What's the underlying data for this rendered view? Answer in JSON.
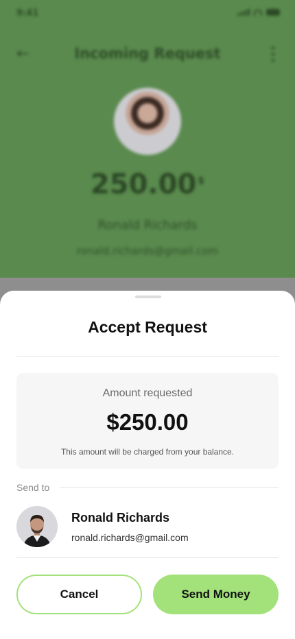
{
  "status_bar": {
    "time": "9:41"
  },
  "background": {
    "header_title": "Incoming Request",
    "amount": "250.00",
    "currency_symbol": "$",
    "name": "Ronald Richards",
    "email": "ronald.richards@gmail.com"
  },
  "sheet": {
    "title": "Accept Request",
    "amount_label": "Amount requested",
    "amount_value": "$250.00",
    "amount_note": "This amount will be charged from your balance.",
    "send_to_label": "Send to",
    "recipient": {
      "name": "Ronald Richards",
      "email": "ronald.richards@gmail.com"
    },
    "cancel_label": "Cancel",
    "send_label": "Send Money"
  },
  "colors": {
    "accent": "#a3e27a",
    "background_green": "#5a8a4e",
    "text_primary": "#111111"
  },
  "icons": [
    "back-arrow-icon",
    "more-vertical-icon",
    "signal-icon",
    "wifi-icon",
    "battery-icon"
  ]
}
